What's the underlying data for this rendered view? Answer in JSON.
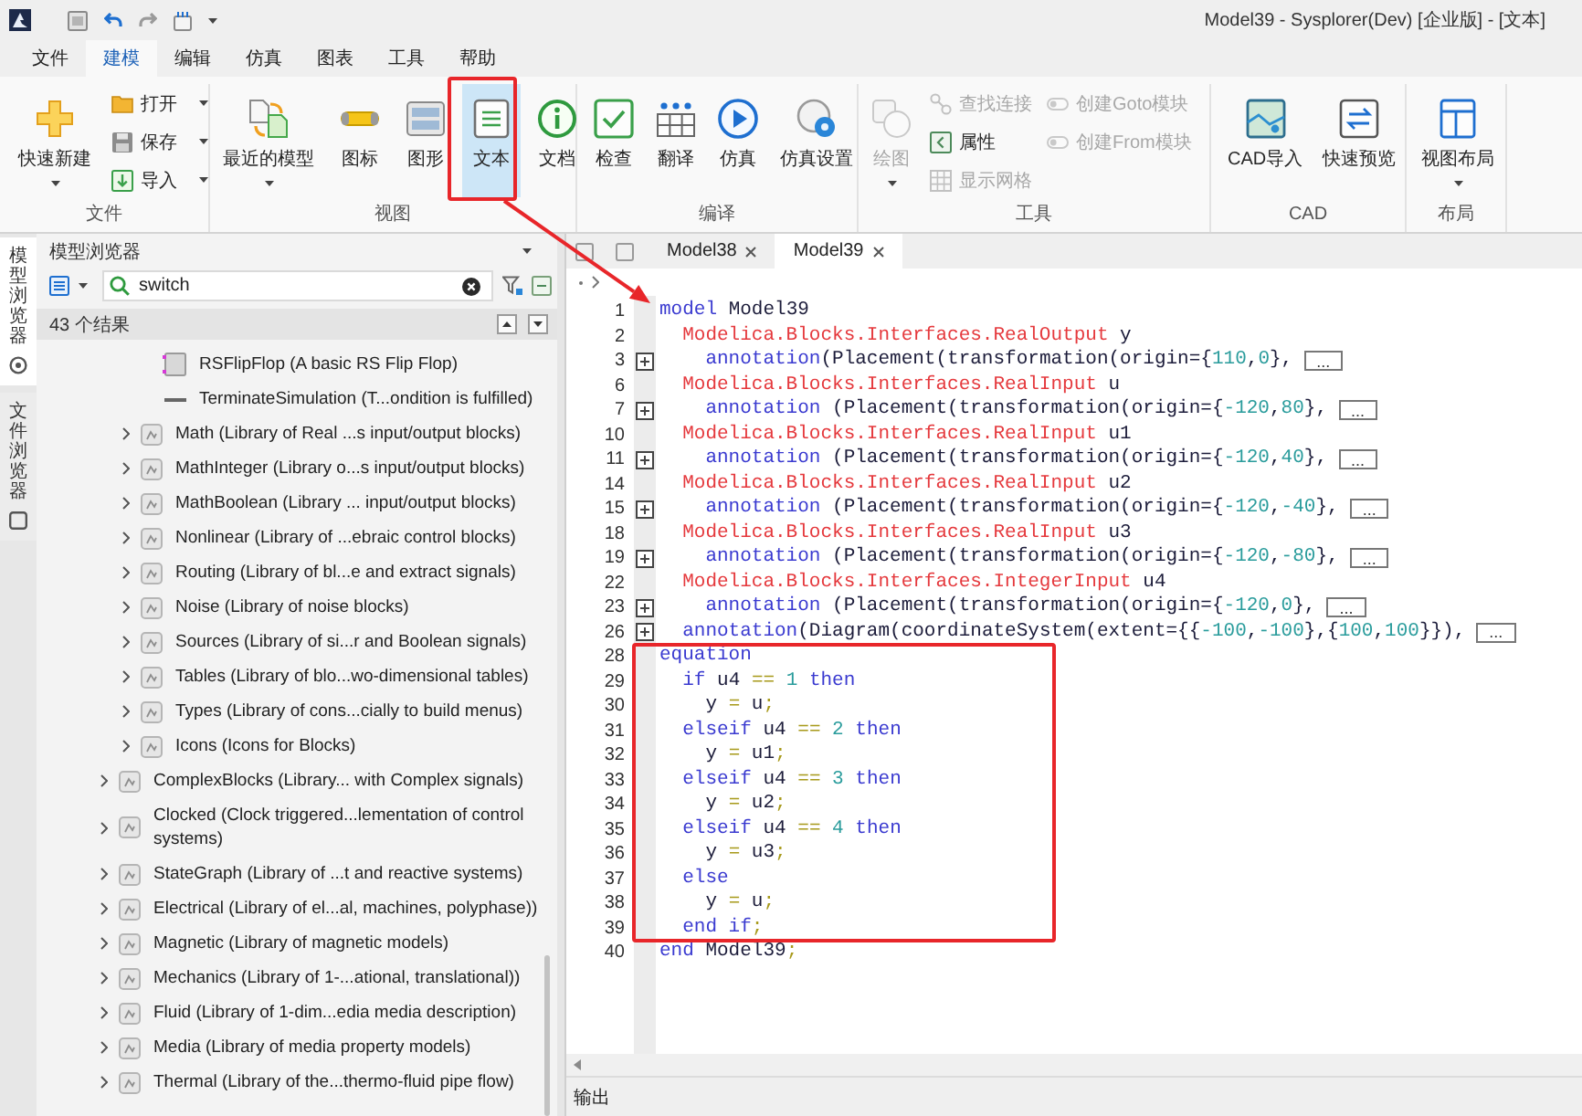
{
  "window": {
    "title": "Model39 - Sysplorer(Dev) [企业版] - [文本]"
  },
  "menu_tabs": [
    {
      "label": "文件",
      "selected": false
    },
    {
      "label": "建模",
      "selected": true
    },
    {
      "label": "编辑",
      "selected": false
    },
    {
      "label": "仿真",
      "selected": false
    },
    {
      "label": "图表",
      "selected": false
    },
    {
      "label": "工具",
      "selected": false
    },
    {
      "label": "帮助",
      "selected": false
    }
  ],
  "ribbon": {
    "groups": [
      {
        "label": "文件",
        "columns": [
          [
            {
              "kind": "large",
              "label": "快速新建",
              "dropdown": true,
              "selected": false,
              "disabled": false
            }
          ],
          [
            {
              "kind": "small",
              "label": "打开",
              "dropdown": true,
              "selected": false,
              "disabled": false
            },
            {
              "kind": "small",
              "label": "保存",
              "dropdown": true,
              "selected": false,
              "disabled": false
            },
            {
              "kind": "small",
              "label": "导入",
              "dropdown": true,
              "selected": false,
              "disabled": false
            }
          ]
        ]
      },
      {
        "label": "视图",
        "columns": [
          [
            {
              "kind": "large",
              "label": "最近的模型",
              "dropdown": true,
              "selected": false,
              "disabled": false
            }
          ],
          [
            {
              "kind": "large",
              "label": "图标",
              "dropdown": false,
              "selected": false,
              "disabled": false
            }
          ],
          [
            {
              "kind": "large",
              "label": "图形",
              "dropdown": false,
              "selected": false,
              "disabled": false
            }
          ],
          [
            {
              "kind": "large",
              "label": "文本",
              "dropdown": false,
              "selected": true,
              "disabled": false
            }
          ],
          [
            {
              "kind": "large",
              "label": "文档",
              "dropdown": false,
              "selected": false,
              "disabled": false
            }
          ]
        ]
      },
      {
        "label": "编译",
        "columns": [
          [
            {
              "kind": "large",
              "label": "检查",
              "dropdown": false,
              "selected": false,
              "disabled": false
            }
          ],
          [
            {
              "kind": "large",
              "label": "翻译",
              "dropdown": false,
              "selected": false,
              "disabled": false
            }
          ],
          [
            {
              "kind": "large",
              "label": "仿真",
              "dropdown": false,
              "selected": false,
              "disabled": false
            }
          ],
          [
            {
              "kind": "large",
              "label": "仿真设置",
              "dropdown": false,
              "selected": false,
              "disabled": false
            }
          ]
        ]
      },
      {
        "label": "工具",
        "columns": [
          [
            {
              "kind": "large",
              "label": "绘图",
              "dropdown": true,
              "selected": false,
              "disabled": true
            }
          ],
          [
            {
              "kind": "small",
              "label": "查找连接",
              "dropdown": false,
              "selected": false,
              "disabled": true
            },
            {
              "kind": "small",
              "label": "属性",
              "dropdown": false,
              "selected": false,
              "disabled": false
            },
            {
              "kind": "small",
              "label": "显示网格",
              "dropdown": false,
              "selected": false,
              "disabled": true
            }
          ],
          [
            {
              "kind": "small",
              "label": "创建Goto模块",
              "dropdown": false,
              "selected": false,
              "disabled": true
            },
            {
              "kind": "small",
              "label": "创建From模块",
              "dropdown": false,
              "selected": false,
              "disabled": true
            }
          ]
        ]
      },
      {
        "label": "CAD",
        "columns": [
          [
            {
              "kind": "large",
              "label": "CAD导入",
              "dropdown": false,
              "selected": false,
              "disabled": false
            }
          ],
          [
            {
              "kind": "large",
              "label": "快速预览",
              "dropdown": false,
              "selected": false,
              "disabled": false
            }
          ]
        ]
      },
      {
        "label": "布局",
        "columns": [
          [
            {
              "kind": "large",
              "label": "视图布局",
              "dropdown": true,
              "selected": false,
              "disabled": false
            }
          ]
        ]
      }
    ]
  },
  "side_tabs": [
    {
      "label": "模型浏览器",
      "selected": true
    },
    {
      "label": "文件浏览器",
      "selected": false
    }
  ],
  "model_browser": {
    "title": "模型浏览器",
    "search": {
      "value": "switch"
    },
    "result_count": "43 个结果",
    "tree": [
      {
        "children": [
          {
            "children": [
              {
                "kind": "block",
                "label": "RSFlipFlop (A basic RS Flip Flop)"
              },
              {
                "kind": "block",
                "label": "TerminateSimulation (T...ondition is fulfilled)"
              }
            ]
          },
          {
            "kind": "package",
            "label": "Math (Library of Real ...s input/output blocks)",
            "expanded": false
          },
          {
            "kind": "package",
            "label": "MathInteger (Library o...s input/output blocks)",
            "expanded": false
          },
          {
            "kind": "package",
            "label": "MathBoolean (Library ... input/output blocks)",
            "expanded": false
          },
          {
            "kind": "package",
            "label": "Nonlinear (Library of ...ebraic control blocks)",
            "expanded": false
          },
          {
            "kind": "package",
            "label": "Routing (Library of bl...e and extract signals)",
            "expanded": false
          },
          {
            "kind": "package",
            "label": "Noise (Library of noise blocks)",
            "expanded": false
          },
          {
            "kind": "package",
            "label": "Sources (Library of si...r and Boolean signals)",
            "expanded": false
          },
          {
            "kind": "package",
            "label": "Tables (Library of blo...wo-dimensional tables)",
            "expanded": false
          },
          {
            "kind": "package",
            "label": "Types (Library of cons...cially to build menus)",
            "expanded": false
          },
          {
            "kind": "package",
            "label": "Icons (Icons for Blocks)",
            "expanded": false
          }
        ]
      },
      {
        "kind": "package",
        "label": "ComplexBlocks (Library... with Complex signals)",
        "expanded": false
      },
      {
        "kind": "package",
        "label": "Clocked (Clock triggered...lementation of control systems)",
        "expanded": false
      },
      {
        "kind": "package",
        "label": "StateGraph (Library of ...t and reactive systems)",
        "expanded": false
      },
      {
        "kind": "package",
        "label": "Electrical (Library of el...al, machines, polyphase))",
        "expanded": false
      },
      {
        "kind": "package",
        "label": "Magnetic (Library of magnetic models)",
        "expanded": false
      },
      {
        "kind": "package",
        "label": "Mechanics (Library of 1-...ational, translational))",
        "expanded": false
      },
      {
        "kind": "package",
        "label": "Fluid (Library of 1-dim...edia media description)",
        "expanded": false
      },
      {
        "kind": "package",
        "label": "Media (Library of media property models)",
        "expanded": false
      },
      {
        "kind": "package",
        "label": "Thermal (Library of the...thermo-fluid pipe flow)",
        "expanded": false
      }
    ]
  },
  "editor": {
    "tabs": [
      {
        "label": "Model38",
        "selected": false
      },
      {
        "label": "Model39",
        "selected": true
      }
    ],
    "lines": [
      {
        "number": "1",
        "folded": false,
        "tokens": [
          {
            "kind": "keyword",
            "text": "model"
          },
          {
            "kind": "plain",
            "text": " Model39"
          }
        ]
      },
      {
        "number": "2",
        "folded": false,
        "tokens": [
          {
            "kind": "type",
            "text": "  Modelica.Blocks.Interfaces.RealOutput"
          },
          {
            "kind": "plain",
            "text": " y"
          }
        ]
      },
      {
        "number": "3",
        "folded": true,
        "fold_label": "...",
        "tokens": [
          {
            "kind": "keyword",
            "text": "    annotation"
          },
          {
            "kind": "plain",
            "text": "(Placement(transformation(origin={"
          },
          {
            "kind": "number",
            "text": "110"
          },
          {
            "kind": "plain",
            "text": ","
          },
          {
            "kind": "number",
            "text": "0"
          },
          {
            "kind": "plain",
            "text": "},"
          }
        ]
      },
      {
        "number": "6",
        "folded": false,
        "tokens": [
          {
            "kind": "type",
            "text": "  Modelica.Blocks.Interfaces.RealInput"
          },
          {
            "kind": "plain",
            "text": " u"
          }
        ]
      },
      {
        "number": "7",
        "folded": true,
        "fold_label": "...",
        "tokens": [
          {
            "kind": "keyword",
            "text": "    annotation"
          },
          {
            "kind": "plain",
            "text": " (Placement(transformation(origin={"
          },
          {
            "kind": "number",
            "text": "-120"
          },
          {
            "kind": "plain",
            "text": ","
          },
          {
            "kind": "number",
            "text": "80"
          },
          {
            "kind": "plain",
            "text": "},"
          }
        ]
      },
      {
        "number": "10",
        "folded": false,
        "tokens": [
          {
            "kind": "type",
            "text": "  Modelica.Blocks.Interfaces.RealInput"
          },
          {
            "kind": "plain",
            "text": " u1"
          }
        ]
      },
      {
        "number": "11",
        "folded": true,
        "fold_label": "...",
        "tokens": [
          {
            "kind": "keyword",
            "text": "    annotation"
          },
          {
            "kind": "plain",
            "text": " (Placement(transformation(origin={"
          },
          {
            "kind": "number",
            "text": "-120"
          },
          {
            "kind": "plain",
            "text": ","
          },
          {
            "kind": "number",
            "text": "40"
          },
          {
            "kind": "plain",
            "text": "},"
          }
        ]
      },
      {
        "number": "14",
        "folded": false,
        "tokens": [
          {
            "kind": "type",
            "text": "  Modelica.Blocks.Interfaces.RealInput"
          },
          {
            "kind": "plain",
            "text": " u2"
          }
        ]
      },
      {
        "number": "15",
        "folded": true,
        "fold_label": "...",
        "tokens": [
          {
            "kind": "keyword",
            "text": "    annotation"
          },
          {
            "kind": "plain",
            "text": " (Placement(transformation(origin={"
          },
          {
            "kind": "number",
            "text": "-120"
          },
          {
            "kind": "plain",
            "text": ","
          },
          {
            "kind": "number",
            "text": "-40"
          },
          {
            "kind": "plain",
            "text": "},"
          }
        ]
      },
      {
        "number": "18",
        "folded": false,
        "tokens": [
          {
            "kind": "type",
            "text": "  Modelica.Blocks.Interfaces.RealInput"
          },
          {
            "kind": "plain",
            "text": " u3"
          }
        ]
      },
      {
        "number": "19",
        "folded": true,
        "fold_label": "...",
        "tokens": [
          {
            "kind": "keyword",
            "text": "    annotation"
          },
          {
            "kind": "plain",
            "text": " (Placement(transformation(origin={"
          },
          {
            "kind": "number",
            "text": "-120"
          },
          {
            "kind": "plain",
            "text": ","
          },
          {
            "kind": "number",
            "text": "-80"
          },
          {
            "kind": "plain",
            "text": "},"
          }
        ]
      },
      {
        "number": "22",
        "folded": false,
        "tokens": [
          {
            "kind": "type",
            "text": "  Modelica.Blocks.Interfaces.IntegerInput"
          },
          {
            "kind": "plain",
            "text": " u4"
          }
        ]
      },
      {
        "number": "23",
        "folded": true,
        "fold_label": "...",
        "tokens": [
          {
            "kind": "keyword",
            "text": "    annotation"
          },
          {
            "kind": "plain",
            "text": " (Placement(transformation(origin={"
          },
          {
            "kind": "number",
            "text": "-120"
          },
          {
            "kind": "plain",
            "text": ","
          },
          {
            "kind": "number",
            "text": "0"
          },
          {
            "kind": "plain",
            "text": "},"
          }
        ]
      },
      {
        "number": "26",
        "folded": true,
        "fold_label": "...",
        "tokens": [
          {
            "kind": "keyword",
            "text": "  annotation"
          },
          {
            "kind": "plain",
            "text": "(Diagram(coordinateSystem(extent={{"
          },
          {
            "kind": "number",
            "text": "-100"
          },
          {
            "kind": "plain",
            "text": ","
          },
          {
            "kind": "number",
            "text": "-100"
          },
          {
            "kind": "plain",
            "text": "},{"
          },
          {
            "kind": "number",
            "text": "100"
          },
          {
            "kind": "plain",
            "text": ","
          },
          {
            "kind": "number",
            "text": "100"
          },
          {
            "kind": "plain",
            "text": "}}),"
          }
        ]
      },
      {
        "number": "28",
        "folded": false,
        "tokens": [
          {
            "kind": "keyword",
            "text": "equation"
          }
        ]
      },
      {
        "number": "29",
        "folded": false,
        "tokens": [
          {
            "kind": "keyword",
            "text": "  if"
          },
          {
            "kind": "plain",
            "text": " u4 "
          },
          {
            "kind": "operator",
            "text": "=="
          },
          {
            "kind": "number",
            "text": " 1"
          },
          {
            "kind": "keyword",
            "text": " then"
          }
        ]
      },
      {
        "number": "30",
        "folded": false,
        "tokens": [
          {
            "kind": "plain",
            "text": "    y "
          },
          {
            "kind": "operator",
            "text": "="
          },
          {
            "kind": "plain",
            "text": " u"
          },
          {
            "kind": "operator",
            "text": ";"
          }
        ]
      },
      {
        "number": "31",
        "folded": false,
        "tokens": [
          {
            "kind": "keyword",
            "text": "  elseif"
          },
          {
            "kind": "plain",
            "text": " u4 "
          },
          {
            "kind": "operator",
            "text": "=="
          },
          {
            "kind": "number",
            "text": " 2"
          },
          {
            "kind": "keyword",
            "text": " then"
          }
        ]
      },
      {
        "number": "32",
        "folded": false,
        "tokens": [
          {
            "kind": "plain",
            "text": "    y "
          },
          {
            "kind": "operator",
            "text": "="
          },
          {
            "kind": "plain",
            "text": " u1"
          },
          {
            "kind": "operator",
            "text": ";"
          }
        ]
      },
      {
        "number": "33",
        "folded": false,
        "tokens": [
          {
            "kind": "keyword",
            "text": "  elseif"
          },
          {
            "kind": "plain",
            "text": " u4 "
          },
          {
            "kind": "operator",
            "text": "=="
          },
          {
            "kind": "number",
            "text": " 3"
          },
          {
            "kind": "keyword",
            "text": " then"
          }
        ]
      },
      {
        "number": "34",
        "folded": false,
        "tokens": [
          {
            "kind": "plain",
            "text": "    y "
          },
          {
            "kind": "operator",
            "text": "="
          },
          {
            "kind": "plain",
            "text": " u2"
          },
          {
            "kind": "operator",
            "text": ";"
          }
        ]
      },
      {
        "number": "35",
        "folded": false,
        "tokens": [
          {
            "kind": "keyword",
            "text": "  elseif"
          },
          {
            "kind": "plain",
            "text": " u4 "
          },
          {
            "kind": "operator",
            "text": "=="
          },
          {
            "kind": "number",
            "text": " 4"
          },
          {
            "kind": "keyword",
            "text": " then"
          }
        ]
      },
      {
        "number": "36",
        "folded": false,
        "tokens": [
          {
            "kind": "plain",
            "text": "    y "
          },
          {
            "kind": "operator",
            "text": "="
          },
          {
            "kind": "plain",
            "text": " u3"
          },
          {
            "kind": "operator",
            "text": ";"
          }
        ]
      },
      {
        "number": "37",
        "folded": false,
        "tokens": [
          {
            "kind": "keyword",
            "text": "  else"
          }
        ]
      },
      {
        "number": "38",
        "folded": false,
        "tokens": [
          {
            "kind": "plain",
            "text": "    y "
          },
          {
            "kind": "operator",
            "text": "="
          },
          {
            "kind": "plain",
            "text": " u"
          },
          {
            "kind": "operator",
            "text": ";"
          }
        ]
      },
      {
        "number": "39",
        "folded": false,
        "tokens": [
          {
            "kind": "keyword",
            "text": "  end if"
          },
          {
            "kind": "operator",
            "text": ";"
          }
        ]
      },
      {
        "number": "40",
        "folded": false,
        "tokens": [
          {
            "kind": "keyword",
            "text": "end"
          },
          {
            "kind": "plain",
            "text": " Model39"
          },
          {
            "kind": "operator",
            "text": ";"
          }
        ]
      }
    ]
  },
  "output_panel": {
    "title": "输出"
  },
  "annotations": [
    {
      "kind": "frame"
    },
    {
      "kind": "arrow"
    },
    {
      "kind": "frame"
    }
  ]
}
